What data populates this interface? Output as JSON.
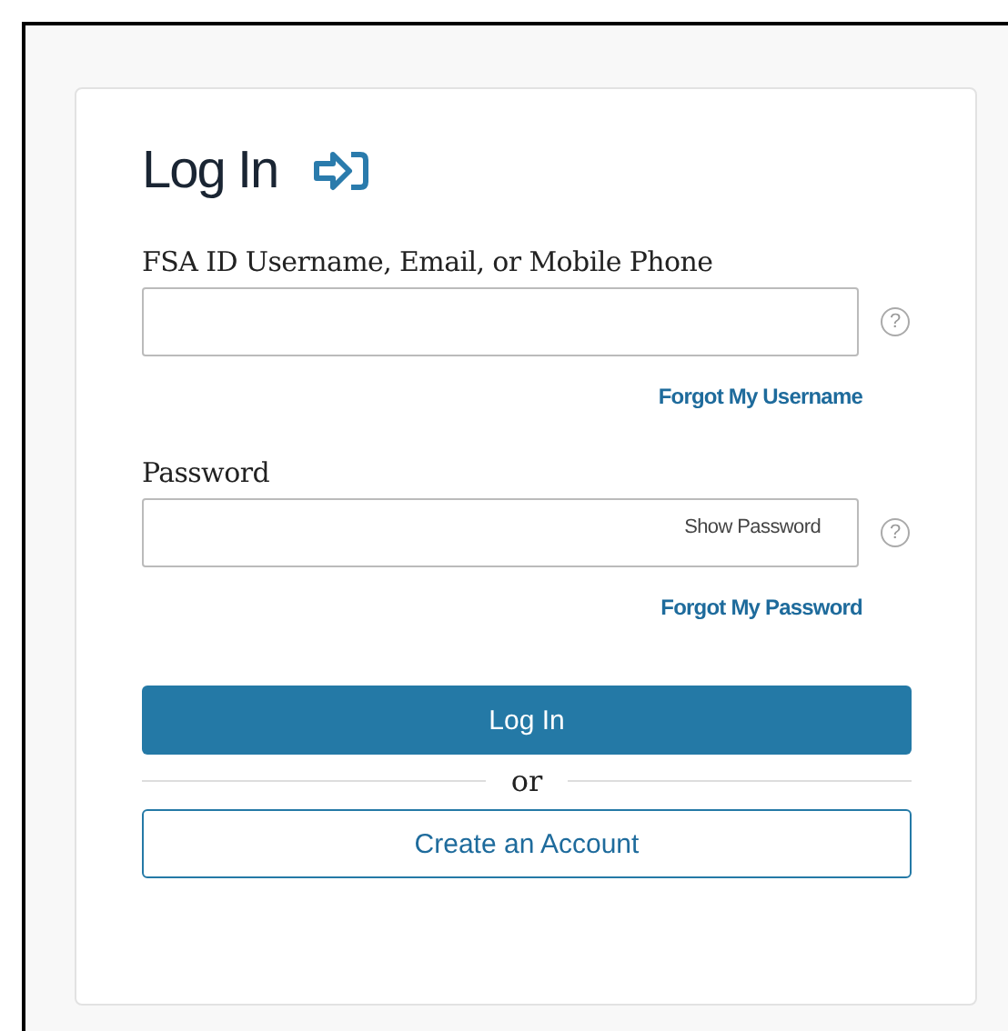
{
  "title": "Log In",
  "fields": [
    {
      "label": "FSA ID Username, Email, or Mobile Phone",
      "help": "?",
      "link": "Forgot My Username"
    },
    {
      "label": "Password",
      "help": "?",
      "link": "Forgot My Password",
      "toggle": "Show Password"
    }
  ],
  "primary_button": "Log In",
  "separator": "or",
  "secondary_button": "Create an Account"
}
